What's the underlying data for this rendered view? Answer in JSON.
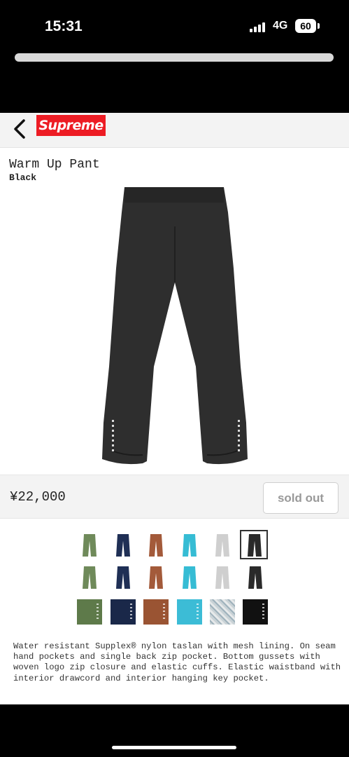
{
  "status_bar": {
    "time": "15:31",
    "network": "4G",
    "battery": "60"
  },
  "header": {
    "brand_logo": "Supreme"
  },
  "product": {
    "name": "Warm Up Pant",
    "color": "Black",
    "price": "¥22,000",
    "button_label": "sold out",
    "description": "Water resistant Supplex® nylon taslan with mesh lining. On seam hand pockets and single back zip pocket. Bottom gussets with woven logo zip closure and elastic cuffs. Elastic waistband with interior drawcord and interior hanging key pocket."
  },
  "swatches": [
    {
      "name": "olive",
      "color": "#6f8a5a",
      "selected": false
    },
    {
      "name": "navy",
      "color": "#1f2f55",
      "selected": false
    },
    {
      "name": "brown",
      "color": "#a35a3a",
      "selected": false
    },
    {
      "name": "cyan",
      "color": "#36bcd4",
      "selected": false
    },
    {
      "name": "light-grey",
      "color": "#cfcfcf",
      "selected": false
    },
    {
      "name": "black",
      "color": "#2a2a2a",
      "selected": true
    }
  ],
  "colors": {
    "logo_red": "#ed1c24",
    "nav_bg": "#f3f3f3",
    "soldout_text": "#999999"
  }
}
